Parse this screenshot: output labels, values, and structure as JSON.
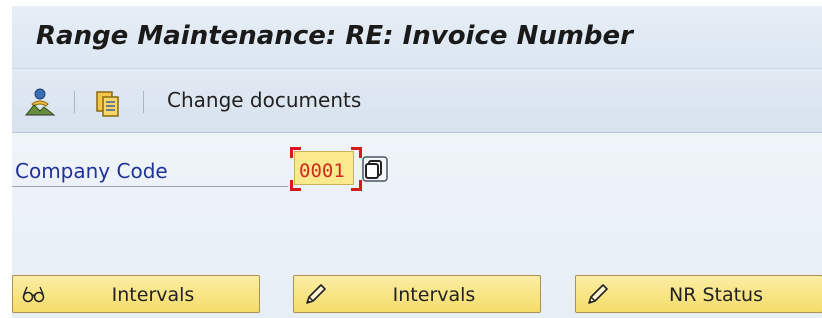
{
  "title": "Range Maintenance: RE: Invoice Number",
  "toolbar": {
    "icons": [
      "person-mountain-icon",
      "copy-documents-icon"
    ],
    "change_documents_label": "Change documents"
  },
  "form": {
    "company_code_label": "Company Code",
    "company_code_value": "0001",
    "search_help_icon": "value-help-icon"
  },
  "buttons": [
    {
      "label": "Intervals",
      "icon": "glasses-display-icon"
    },
    {
      "label": "Intervals",
      "icon": "pencil-edit-icon"
    },
    {
      "label": "NR Status",
      "icon": "pencil-edit-icon"
    }
  ],
  "colors": {
    "label_blue": "#21319a",
    "input_bg": "#fbe98e",
    "input_text": "#d12a1e",
    "focus_corners": "#d8191b",
    "button_bg": "#f5dc6a"
  }
}
